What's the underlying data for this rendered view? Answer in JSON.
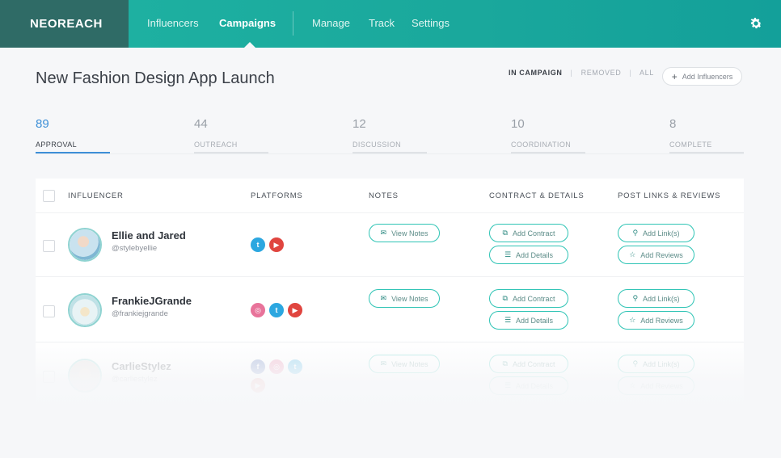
{
  "brand": {
    "logo": "NEOREACH"
  },
  "nav": {
    "items": [
      {
        "label": "Influencers"
      },
      {
        "label": "Campaigns"
      },
      {
        "label": "Manage"
      },
      {
        "label": "Track"
      },
      {
        "label": "Settings"
      }
    ],
    "active": "Campaigns"
  },
  "page": {
    "title": "New Fashion Design App Launch",
    "filters": {
      "in_campaign": "IN CAMPAIGN",
      "removed": "REMOVED",
      "all": "ALL",
      "separator": "|"
    },
    "add_button": "Add Influencers"
  },
  "stages": [
    {
      "count": "89",
      "label": "APPROVAL"
    },
    {
      "count": "44",
      "label": "OUTREACH"
    },
    {
      "count": "12",
      "label": "DISCUSSION"
    },
    {
      "count": "10",
      "label": "COORDINATION"
    },
    {
      "count": "8",
      "label": "COMPLETE"
    }
  ],
  "table": {
    "headers": {
      "influencer": "INFLUENCER",
      "platforms": "PLATFORMS",
      "notes": "NOTES",
      "contract": "CONTRACT & DETAILS",
      "posts": "POST LINKS & REVIEWS"
    },
    "buttons": {
      "view_notes": "View Notes",
      "add_contract": "Add Contract",
      "add_details": "Add Details",
      "add_links": "Add Link(s)",
      "add_reviews": "Add Reviews"
    },
    "rows": [
      {
        "name": "Ellie and Jared",
        "handle": "@stylebyellie",
        "platforms": [
          "twitter",
          "youtube"
        ]
      },
      {
        "name": "FrankieJGrande",
        "handle": "@frankiejgrande",
        "platforms": [
          "instagram",
          "twitter",
          "youtube"
        ]
      },
      {
        "name": "CarlieStylez",
        "handle": "@carliestylez",
        "platforms": [
          "facebook",
          "instagram",
          "twitter",
          "youtube"
        ]
      }
    ]
  },
  "colors": {
    "nav_teal": "#1fb3a3",
    "logo_bg": "#2f6b66",
    "accent_blue": "#3d8fd7",
    "pill_border": "#2fc4b5"
  }
}
